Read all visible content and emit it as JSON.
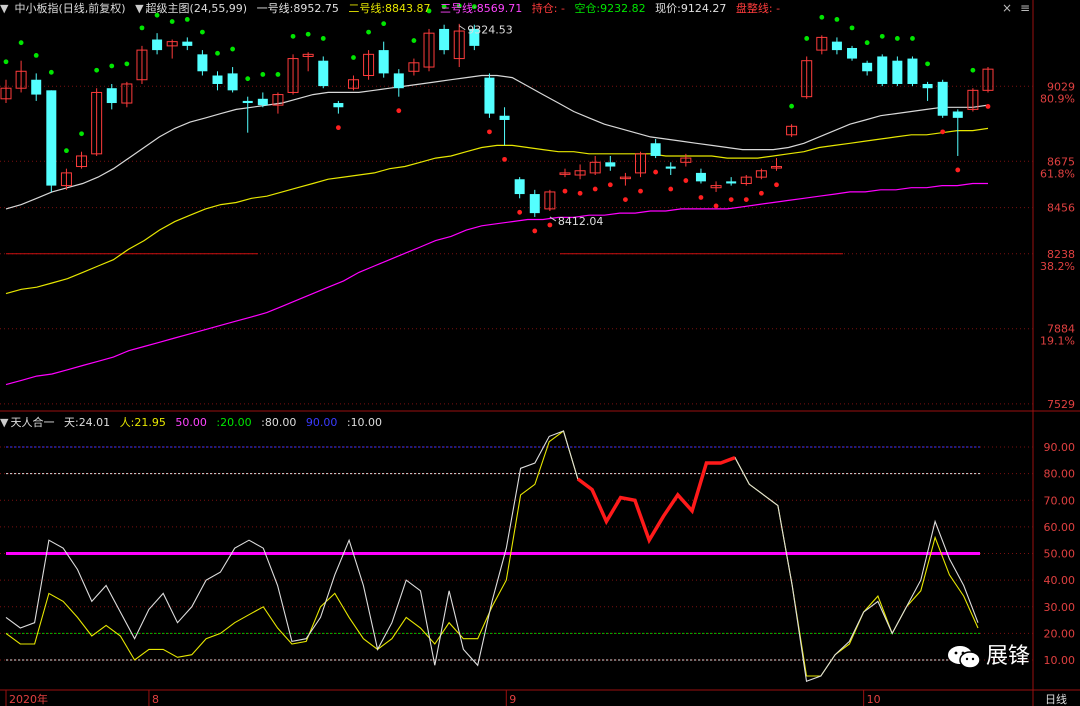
{
  "header_main": {
    "symbol": "中小板指(日线,前复权)",
    "indicator": "超级主图(24,55,99)",
    "line1_label": "一号线:",
    "line1_value": "8952.75",
    "line2_label": "二号线:",
    "line2_value": "8843.87",
    "line3_label": "三号线:",
    "line3_value": "8569.71",
    "hold_label": "持仓: -",
    "empty_label": "空仓:",
    "empty_value": "9232.82",
    "price_label": "现价:",
    "price_value": "9124.27",
    "profit_label": "盘整线: -"
  },
  "header_sub": {
    "indicator": "天人合一",
    "tian_label": "天:",
    "tian_value": "24.01",
    "ren_label": "人:",
    "ren_value": "21.95",
    "l50": "50.00",
    "l20": "20.00",
    "l80": "80.00",
    "l90": "90.00",
    "l10": "10.00"
  },
  "colors": {
    "up": "#ff3c3c",
    "down": "#54ffff",
    "dot_green": "#00e600",
    "dot_red": "#ff2020",
    "ma1": "#d8d8d8",
    "ma2": "#e6e600",
    "ma3": "#ff00ff"
  },
  "watermark": "展锋",
  "chart_data": [
    {
      "type": "candlestick",
      "price_axis": {
        "ticks": [
          9029,
          8675,
          8456,
          8238,
          7884,
          7529
        ],
        "fib_labels": [
          {
            "price": 9029,
            "text": "80.9%"
          },
          {
            "price": 8675,
            "text": "61.8%"
          },
          {
            "price": 8238,
            "text": "38.2%"
          },
          {
            "price": 7884,
            "text": "19.1%"
          }
        ]
      },
      "annotations": [
        {
          "text": "9324.53",
          "price": 9324.53,
          "index": 30
        },
        {
          "text": "8412.04",
          "price": 8412.04,
          "index": 36
        }
      ],
      "support_price": 8238,
      "candles": [
        {
          "o": 8970,
          "h": 9060,
          "l": 8950,
          "c": 9020
        },
        {
          "o": 9020,
          "h": 9150,
          "l": 9000,
          "c": 9100
        },
        {
          "o": 9060,
          "h": 9090,
          "l": 8960,
          "c": 8990
        },
        {
          "o": 9010,
          "h": 9010,
          "l": 8530,
          "c": 8560
        },
        {
          "o": 8560,
          "h": 8640,
          "l": 8540,
          "c": 8620
        },
        {
          "o": 8650,
          "h": 8720,
          "l": 8640,
          "c": 8700
        },
        {
          "o": 8710,
          "h": 9020,
          "l": 8700,
          "c": 9000
        },
        {
          "o": 9020,
          "h": 9040,
          "l": 8920,
          "c": 8950
        },
        {
          "o": 8950,
          "h": 9050,
          "l": 8930,
          "c": 9040
        },
        {
          "o": 9060,
          "h": 9220,
          "l": 9040,
          "c": 9200
        },
        {
          "o": 9250,
          "h": 9280,
          "l": 9180,
          "c": 9200
        },
        {
          "o": 9220,
          "h": 9250,
          "l": 9160,
          "c": 9240
        },
        {
          "o": 9240,
          "h": 9260,
          "l": 9200,
          "c": 9220
        },
        {
          "o": 9180,
          "h": 9200,
          "l": 9080,
          "c": 9100
        },
        {
          "o": 9080,
          "h": 9100,
          "l": 9010,
          "c": 9040
        },
        {
          "o": 9090,
          "h": 9120,
          "l": 9000,
          "c": 9010
        },
        {
          "o": 8960,
          "h": 8980,
          "l": 8810,
          "c": 8950
        },
        {
          "o": 8970,
          "h": 9000,
          "l": 8930,
          "c": 8940
        },
        {
          "o": 8940,
          "h": 9000,
          "l": 8900,
          "c": 8990
        },
        {
          "o": 9000,
          "h": 9180,
          "l": 8990,
          "c": 9160
        },
        {
          "o": 9170,
          "h": 9190,
          "l": 9100,
          "c": 9180
        },
        {
          "o": 9150,
          "h": 9170,
          "l": 9020,
          "c": 9030
        },
        {
          "o": 8950,
          "h": 8960,
          "l": 8900,
          "c": 8930
        },
        {
          "o": 9020,
          "h": 9080,
          "l": 9010,
          "c": 9060
        },
        {
          "o": 9080,
          "h": 9200,
          "l": 9060,
          "c": 9180
        },
        {
          "o": 9200,
          "h": 9240,
          "l": 9070,
          "c": 9090
        },
        {
          "o": 9090,
          "h": 9110,
          "l": 8980,
          "c": 9020
        },
        {
          "o": 9100,
          "h": 9160,
          "l": 9080,
          "c": 9140
        },
        {
          "o": 9120,
          "h": 9300,
          "l": 9100,
          "c": 9280
        },
        {
          "o": 9300,
          "h": 9320,
          "l": 9180,
          "c": 9200
        },
        {
          "o": 9160,
          "h": 9324,
          "l": 9120,
          "c": 9290
        },
        {
          "o": 9300,
          "h": 9320,
          "l": 9200,
          "c": 9220
        },
        {
          "o": 9070,
          "h": 9090,
          "l": 8880,
          "c": 8900
        },
        {
          "o": 8890,
          "h": 8930,
          "l": 8750,
          "c": 8870
        },
        {
          "o": 8590,
          "h": 8600,
          "l": 8500,
          "c": 8520
        },
        {
          "o": 8520,
          "h": 8540,
          "l": 8412,
          "c": 8430
        },
        {
          "o": 8450,
          "h": 8540,
          "l": 8440,
          "c": 8530
        },
        {
          "o": 8620,
          "h": 8640,
          "l": 8600,
          "c": 8620
        },
        {
          "o": 8610,
          "h": 8660,
          "l": 8590,
          "c": 8630
        },
        {
          "o": 8620,
          "h": 8700,
          "l": 8610,
          "c": 8670
        },
        {
          "o": 8670,
          "h": 8700,
          "l": 8630,
          "c": 8650
        },
        {
          "o": 8600,
          "h": 8620,
          "l": 8560,
          "c": 8600
        },
        {
          "o": 8620,
          "h": 8720,
          "l": 8600,
          "c": 8710
        },
        {
          "o": 8760,
          "h": 8780,
          "l": 8690,
          "c": 8700
        },
        {
          "o": 8650,
          "h": 8670,
          "l": 8610,
          "c": 8640
        },
        {
          "o": 8670,
          "h": 8710,
          "l": 8650,
          "c": 8690
        },
        {
          "o": 8620,
          "h": 8640,
          "l": 8570,
          "c": 8580
        },
        {
          "o": 8550,
          "h": 8580,
          "l": 8530,
          "c": 8560
        },
        {
          "o": 8580,
          "h": 8600,
          "l": 8560,
          "c": 8570
        },
        {
          "o": 8570,
          "h": 8610,
          "l": 8560,
          "c": 8600
        },
        {
          "o": 8600,
          "h": 8640,
          "l": 8590,
          "c": 8630
        },
        {
          "o": 8650,
          "h": 8690,
          "l": 8630,
          "c": 8650
        },
        {
          "o": 8800,
          "h": 8850,
          "l": 8790,
          "c": 8840
        },
        {
          "o": 8980,
          "h": 9170,
          "l": 8970,
          "c": 9150
        },
        {
          "o": 9200,
          "h": 9270,
          "l": 9180,
          "c": 9260
        },
        {
          "o": 9240,
          "h": 9260,
          "l": 9180,
          "c": 9200
        },
        {
          "o": 9210,
          "h": 9220,
          "l": 9150,
          "c": 9160
        },
        {
          "o": 9140,
          "h": 9150,
          "l": 9080,
          "c": 9100
        },
        {
          "o": 9170,
          "h": 9180,
          "l": 9030,
          "c": 9040
        },
        {
          "o": 9150,
          "h": 9170,
          "l": 9030,
          "c": 9040
        },
        {
          "o": 9160,
          "h": 9170,
          "l": 9030,
          "c": 9040
        },
        {
          "o": 9040,
          "h": 9050,
          "l": 8960,
          "c": 9020
        },
        {
          "o": 9050,
          "h": 9060,
          "l": 8880,
          "c": 8890
        },
        {
          "o": 8910,
          "h": 8920,
          "l": 8700,
          "c": 8880
        },
        {
          "o": 8920,
          "h": 9020,
          "l": 8910,
          "c": 9010
        },
        {
          "o": 9010,
          "h": 9120,
          "l": 9000,
          "c": 9110
        }
      ],
      "series": [
        {
          "name": "一号线",
          "values": [
            8450,
            8470,
            8500,
            8530,
            8550,
            8570,
            8600,
            8640,
            8690,
            8740,
            8790,
            8830,
            8860,
            8880,
            8900,
            8920,
            8930,
            8940,
            8950,
            8970,
            8990,
            9000,
            9000,
            9000,
            9010,
            9020,
            9030,
            9040,
            9050,
            9060,
            9070,
            9080,
            9080,
            9070,
            9030,
            8990,
            8950,
            8910,
            8880,
            8850,
            8830,
            8810,
            8790,
            8780,
            8770,
            8760,
            8750,
            8740,
            8730,
            8730,
            8730,
            8740,
            8760,
            8790,
            8820,
            8850,
            8870,
            8890,
            8900,
            8910,
            8920,
            8930,
            8930,
            8930,
            8940
          ]
        },
        {
          "name": "二号线",
          "values": [
            8050,
            8070,
            8080,
            8100,
            8120,
            8150,
            8180,
            8210,
            8260,
            8300,
            8350,
            8390,
            8420,
            8450,
            8470,
            8480,
            8500,
            8510,
            8530,
            8550,
            8570,
            8590,
            8600,
            8610,
            8620,
            8640,
            8650,
            8670,
            8690,
            8700,
            8720,
            8740,
            8750,
            8750,
            8740,
            8730,
            8720,
            8720,
            8710,
            8710,
            8710,
            8710,
            8710,
            8700,
            8700,
            8700,
            8700,
            8690,
            8690,
            8690,
            8700,
            8710,
            8720,
            8740,
            8750,
            8760,
            8770,
            8780,
            8790,
            8800,
            8800,
            8810,
            8820,
            8820,
            8830
          ]
        },
        {
          "name": "三号线",
          "values": [
            7620,
            7640,
            7660,
            7670,
            7690,
            7710,
            7730,
            7750,
            7780,
            7800,
            7820,
            7840,
            7860,
            7880,
            7900,
            7920,
            7940,
            7960,
            7990,
            8020,
            8050,
            8080,
            8110,
            8150,
            8180,
            8210,
            8240,
            8270,
            8300,
            8320,
            8350,
            8370,
            8380,
            8390,
            8400,
            8400,
            8410,
            8410,
            8420,
            8420,
            8430,
            8430,
            8440,
            8440,
            8450,
            8450,
            8450,
            8450,
            8460,
            8470,
            8480,
            8490,
            8500,
            8510,
            8520,
            8530,
            8530,
            8540,
            8540,
            8550,
            8550,
            8560,
            8560,
            8570,
            8570
          ]
        }
      ]
    },
    {
      "type": "line",
      "title": "天人合一",
      "ylim": [
        0,
        100
      ],
      "y_ticks": [
        90,
        80,
        70,
        60,
        50,
        40,
        30,
        20,
        10
      ],
      "reference_lines": [
        90,
        80,
        50,
        20,
        10
      ],
      "x_labels": [
        {
          "index": 0,
          "text": "2020年"
        },
        {
          "index": 10,
          "text": "8"
        },
        {
          "index": 33,
          "text": "9"
        },
        {
          "index": 57,
          "text": "10"
        }
      ],
      "period_label": "日线",
      "series": [
        {
          "name": "天",
          "values": [
            26,
            22,
            24,
            55,
            52,
            44,
            32,
            38,
            28,
            18,
            29,
            35,
            24,
            30,
            40,
            43,
            52,
            55,
            52,
            38,
            17,
            18,
            26,
            42,
            55,
            38,
            14,
            24,
            40,
            36,
            8,
            36,
            14,
            8,
            32,
            52,
            82,
            84,
            94,
            96,
            78,
            74,
            62,
            71,
            70,
            55,
            64,
            72,
            66,
            84,
            84,
            86,
            76,
            72,
            68,
            38,
            2,
            4,
            12,
            17,
            28,
            32,
            20,
            30,
            40,
            62,
            48,
            38,
            24
          ]
        },
        {
          "name": "人",
          "values": [
            20,
            16,
            16,
            35,
            32,
            26,
            19,
            23,
            19,
            10,
            14,
            14,
            11,
            12,
            18,
            20,
            24,
            27,
            30,
            22,
            16,
            17,
            30,
            35,
            26,
            18,
            14,
            18,
            26,
            22,
            16,
            24,
            18,
            18,
            30,
            40,
            72,
            76,
            92,
            96,
            78,
            74,
            62,
            71,
            70,
            55,
            64,
            72,
            66,
            84,
            84,
            86,
            76,
            72,
            68,
            38,
            4,
            4,
            12,
            16,
            28,
            34,
            20,
            30,
            36,
            56,
            42,
            34,
            22
          ]
        }
      ]
    }
  ]
}
